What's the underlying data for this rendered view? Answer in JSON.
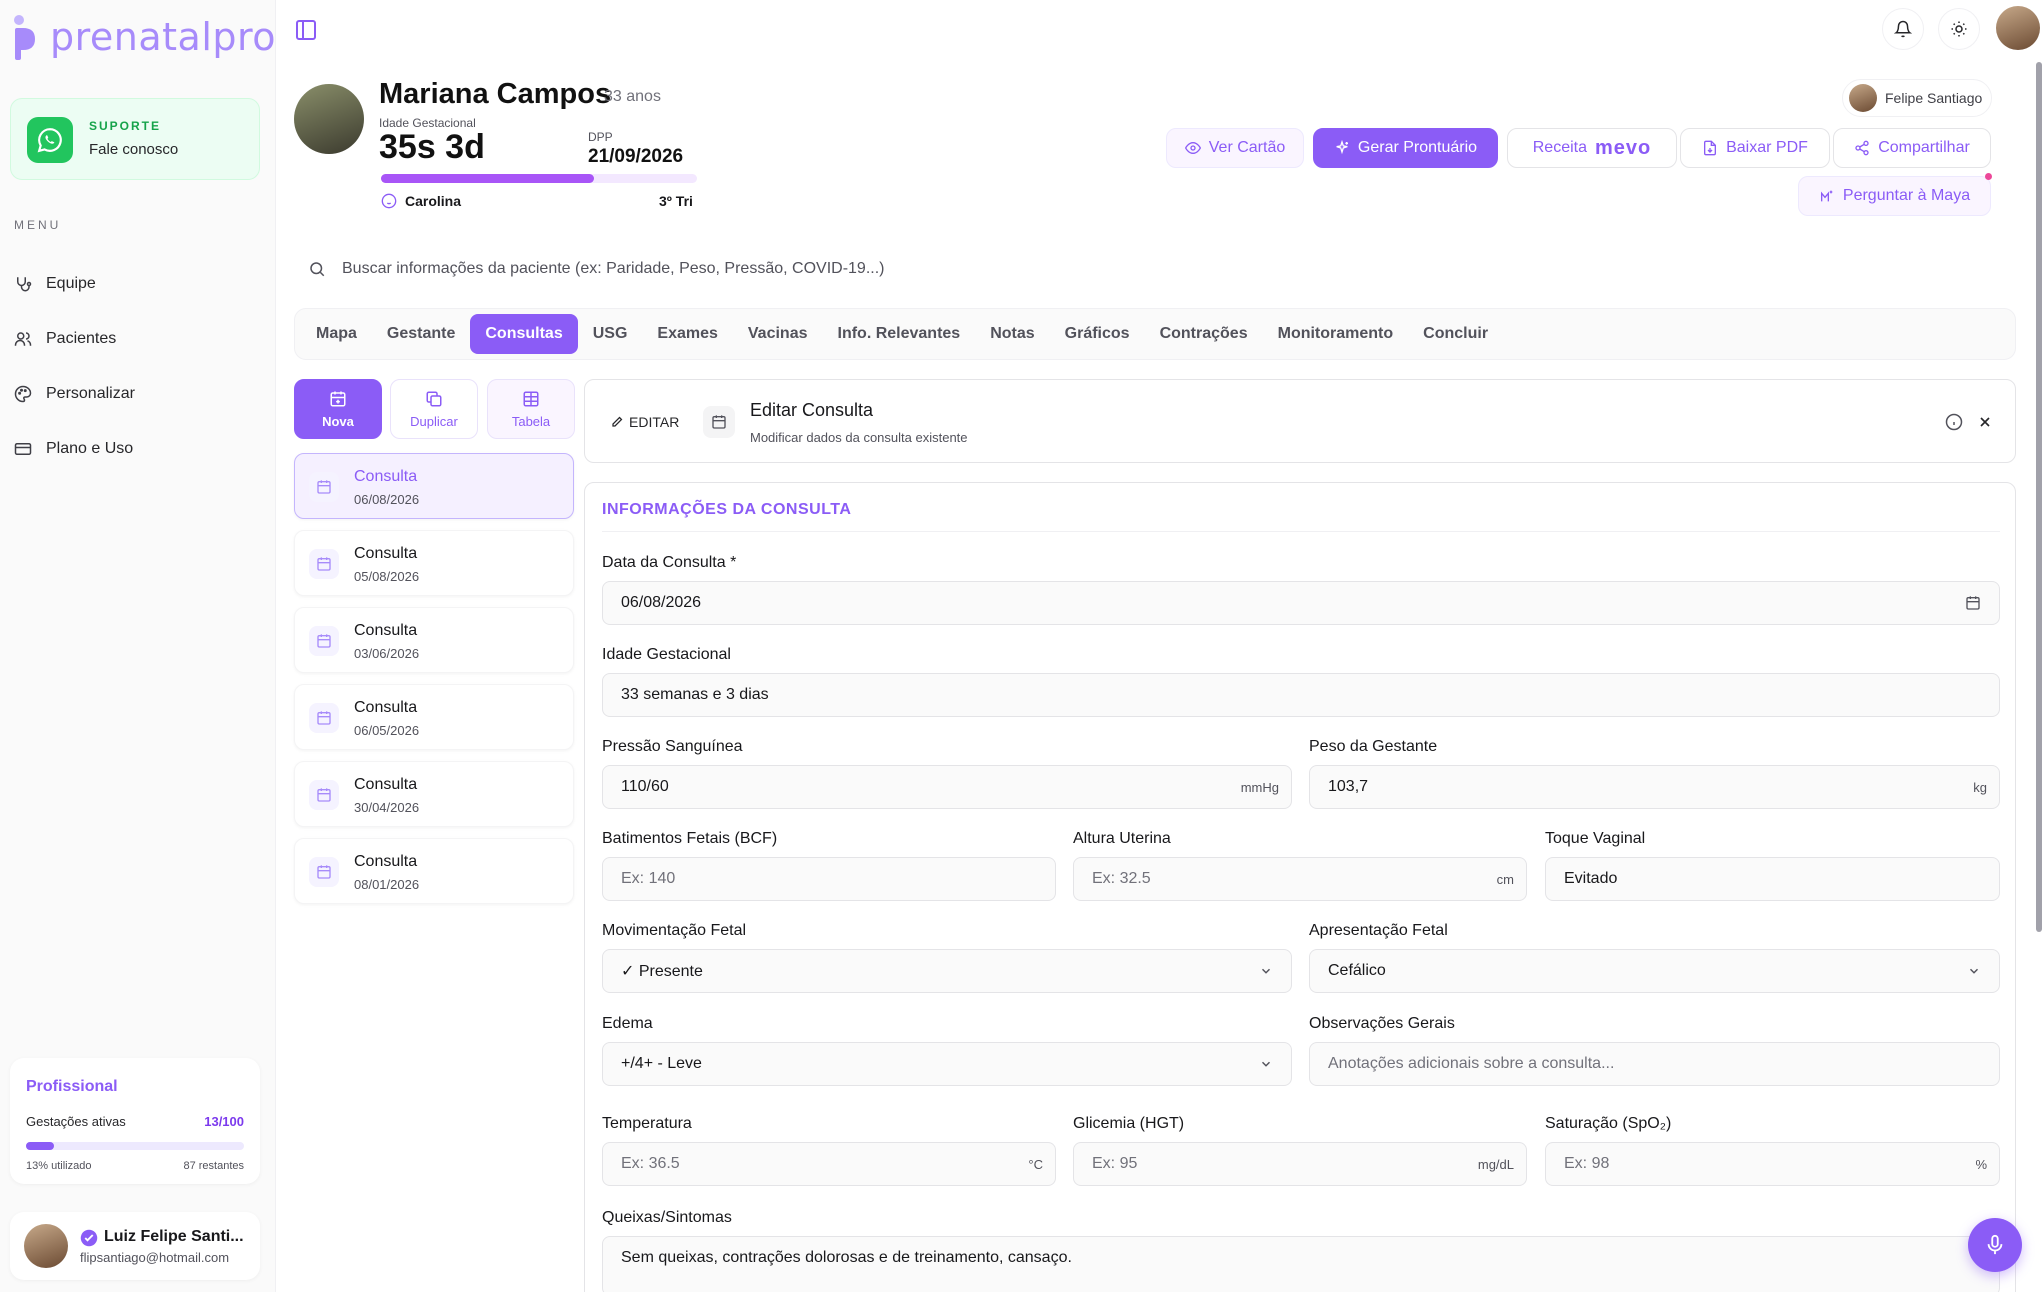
{
  "brand": {
    "name": "prenatalpro",
    "accent": "#8b5cf6"
  },
  "support": {
    "kicker": "SUPORTE",
    "label": "Fale conosco"
  },
  "menu": {
    "heading": "MENU",
    "items": [
      {
        "label": "Equipe",
        "icon": "stethoscope-icon"
      },
      {
        "label": "Pacientes",
        "icon": "users-icon"
      },
      {
        "label": "Personalizar",
        "icon": "palette-icon"
      },
      {
        "label": "Plano e Uso",
        "icon": "credit-card-icon"
      }
    ]
  },
  "plan": {
    "title": "Profissional",
    "label": "Gestações ativas",
    "count": "13/100",
    "used_fraction": 0.13,
    "used_text": "13% utilizado",
    "remaining_text": "87 restantes"
  },
  "user": {
    "name": "Luiz Felipe Santi...",
    "email": "flipsantiago@hotmail.com"
  },
  "patient": {
    "name": "Mariana Campos",
    "age": "33 anos",
    "ig_label": "Idade Gestacional",
    "ig_value": "35s 3d",
    "dpp_label": "DPP",
    "dpp_value": "21/09/2026",
    "progress_fraction": 0.675,
    "baby_name": "Carolina",
    "trimester": "3º Tri"
  },
  "doctor_chip": "Felipe Santiago",
  "actions": {
    "ver_cartao": "Ver Cartão",
    "gerar_prontuario": "Gerar Prontuário",
    "receita": "Receita",
    "mevo": "mevo",
    "baixar_pdf": "Baixar PDF",
    "compartilhar": "Compartilhar",
    "perguntar": "Perguntar à Maya"
  },
  "search": {
    "placeholder": "Buscar informações da paciente (ex: Paridade, Peso, Pressão, COVID-19...)"
  },
  "tabs": [
    "Mapa",
    "Gestante",
    "Consultas",
    "USG",
    "Exames",
    "Vacinas",
    "Info. Relevantes",
    "Notas",
    "Gráficos",
    "Contrações",
    "Monitoramento",
    "Concluir"
  ],
  "active_tab": "Consultas",
  "quick_actions": {
    "nova": "Nova",
    "duplicar": "Duplicar",
    "tabela": "Tabela"
  },
  "consultas": [
    {
      "title": "Consulta",
      "date": "06/08/2026"
    },
    {
      "title": "Consulta",
      "date": "05/08/2026"
    },
    {
      "title": "Consulta",
      "date": "03/06/2026"
    },
    {
      "title": "Consulta",
      "date": "06/05/2026"
    },
    {
      "title": "Consulta",
      "date": "30/04/2026"
    },
    {
      "title": "Consulta",
      "date": "08/01/2026"
    }
  ],
  "editor": {
    "badge": "EDITAR",
    "title": "Editar Consulta",
    "subtitle": "Modificar dados da consulta existente"
  },
  "form": {
    "section": "INFORMAÇÕES DA CONSULTA",
    "data_label": "Data da Consulta *",
    "data_value": "06/08/2026",
    "ig_label": "Idade Gestacional",
    "ig_value": "33 semanas e 3 dias",
    "pa_label": "Pressão Sanguínea",
    "pa_value": "110/60",
    "pa_unit": "mmHg",
    "peso_label": "Peso da Gestante",
    "peso_value": "103,7",
    "peso_unit": "kg",
    "bcf_label": "Batimentos Fetais (BCF)",
    "bcf_placeholder": "Ex: 140",
    "au_label": "Altura Uterina",
    "au_placeholder": "Ex: 32.5",
    "au_unit": "cm",
    "toque_label": "Toque Vaginal",
    "toque_value": "Evitado",
    "mov_label": "Movimentação Fetal",
    "mov_value": "✓ Presente",
    "apres_label": "Apresentação Fetal",
    "apres_value": "Cefálico",
    "edema_label": "Edema",
    "edema_value": "+/4+ - Leve",
    "obs_label": "Observações Gerais",
    "obs_placeholder": "Anotações adicionais sobre a consulta...",
    "temp_label": "Temperatura",
    "temp_placeholder": "Ex: 36.5",
    "temp_unit": "°C",
    "gli_label": "Glicemia (HGT)",
    "gli_placeholder": "Ex: 95",
    "gli_unit": "mg/dL",
    "sat_label": "Saturação (SpO₂)",
    "sat_placeholder": "Ex: 98",
    "sat_unit": "%",
    "queixas_label": "Queixas/Sintomas",
    "queixas_value": "Sem queixas, contrações dolorosas e de treinamento, cansaço."
  }
}
